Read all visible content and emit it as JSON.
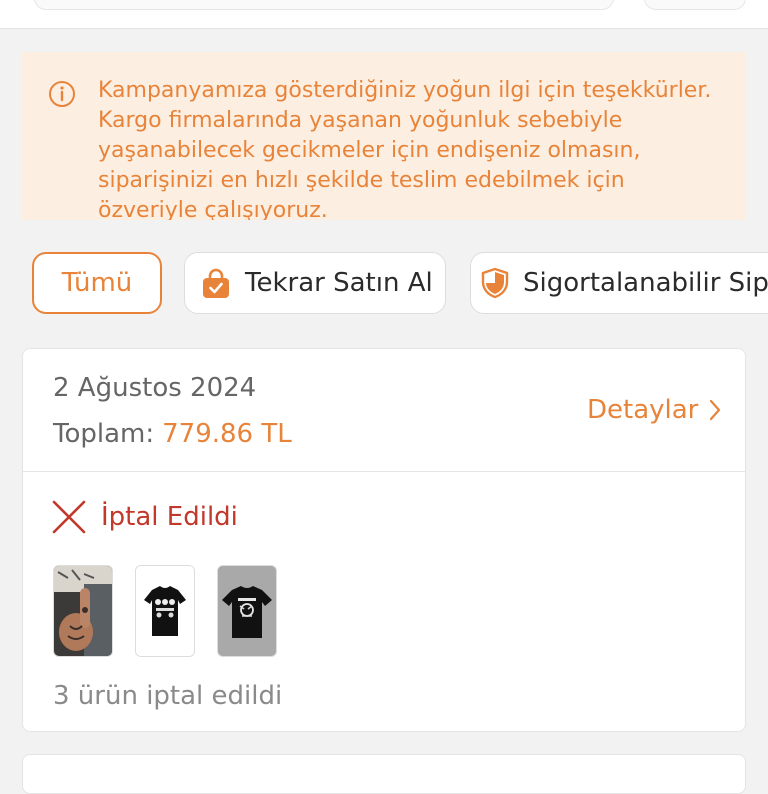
{
  "notice": {
    "icon": "info-icon",
    "text": "Kampanyamıza gösterdiğiniz yoğun ilgi için teşekkürler. Kargo firmalarında yaşanan yoğunluk sebebiyle yaşanabilecek gecikmeler için endişeniz olmasın, siparişinizi en hızlı şekilde teslim edebilmek için özveriyle çalışıyoruz."
  },
  "filters": [
    {
      "label": "Tümü",
      "active": true
    },
    {
      "label": "Tekrar Satın Al",
      "icon": "shopping-bag-icon"
    },
    {
      "label": "Sigortalanabilir Sipa",
      "icon": "shield-icon"
    }
  ],
  "order": {
    "date": "2 Ağustos 2024",
    "total_label": "Toplam:",
    "total_value": "779.86 TL",
    "details_label": "Detaylar",
    "status_label": "İptal Edildi",
    "status_icon": "close-icon",
    "product_images": [
      "product-photo-tattooed-hands",
      "product-black-tshirt-print",
      "product-black-tshirt-graphic"
    ],
    "footer_text": "3 ürün iptal edildi"
  },
  "colors": {
    "accent": "#e8843a",
    "notice_bg": "#fcefe2",
    "cancel_red": "#c0392b",
    "page_bg": "#f2f2f2"
  }
}
